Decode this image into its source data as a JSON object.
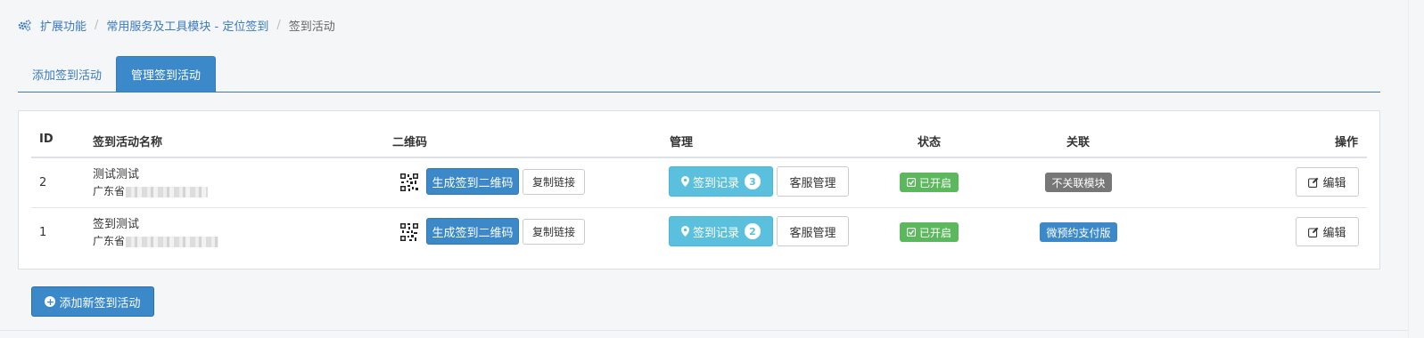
{
  "breadcrumb": {
    "items": [
      "扩展功能",
      "常用服务及工具模块 - 定位签到",
      "签到活动"
    ],
    "separator": "/"
  },
  "tabs": [
    "添加签到活动",
    "管理签到活动"
  ],
  "table": {
    "headers": [
      "ID",
      "签到活动名称",
      "二维码",
      "管理",
      "状态",
      "关联",
      "操作"
    ],
    "rows": [
      {
        "id": "2",
        "name": "测试测试",
        "address": "广东省",
        "qr_button": "生成签到二维码",
        "copy_button": "复制链接",
        "record_button": "签到记录",
        "record_count": "3",
        "service_button": "客服管理",
        "status": "已开启",
        "relation": "不关联模块",
        "edit_button": "编辑"
      },
      {
        "id": "1",
        "name": "签到测试",
        "address": "广东省",
        "qr_button": "生成签到二维码",
        "copy_button": "复制链接",
        "record_button": "签到记录",
        "record_count": "2",
        "service_button": "客服管理",
        "status": "已开启",
        "relation": "微预约支付版",
        "edit_button": "编辑"
      }
    ]
  },
  "add_button": "添加新签到活动",
  "colors": {
    "primary": "#3c89c9",
    "info": "#5bc0de",
    "success": "#5cb85c",
    "gray": "#777777"
  }
}
